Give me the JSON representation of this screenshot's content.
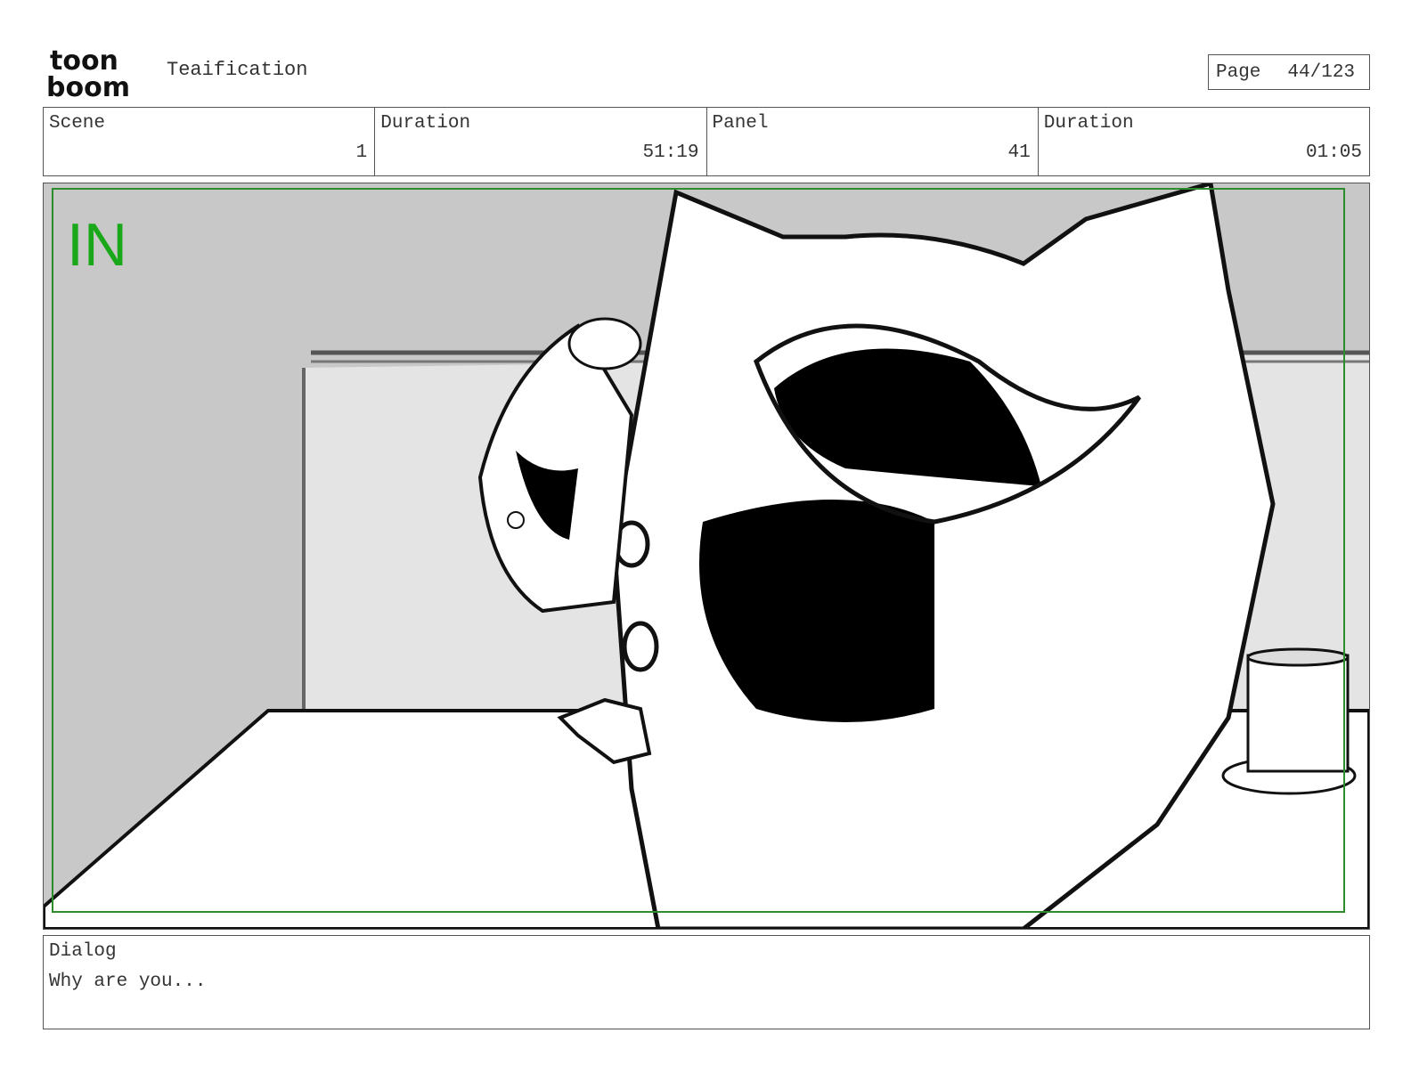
{
  "header": {
    "logo_line1": "toon",
    "logo_line2": "boom",
    "title": "Teaification",
    "page_label": "Page",
    "page_value": "44/123"
  },
  "info": [
    {
      "label": "Scene",
      "value": "1"
    },
    {
      "label": "Duration",
      "value": "51:19"
    },
    {
      "label": "Panel",
      "value": "41"
    },
    {
      "label": "Duration",
      "value": "01:05"
    }
  ],
  "panel": {
    "overlay_text": "IN",
    "overlay_color": "#1aa81a",
    "safe_frame_color": "#2e8b2e"
  },
  "dialog": {
    "label": "Dialog",
    "text": "Why are you..."
  }
}
